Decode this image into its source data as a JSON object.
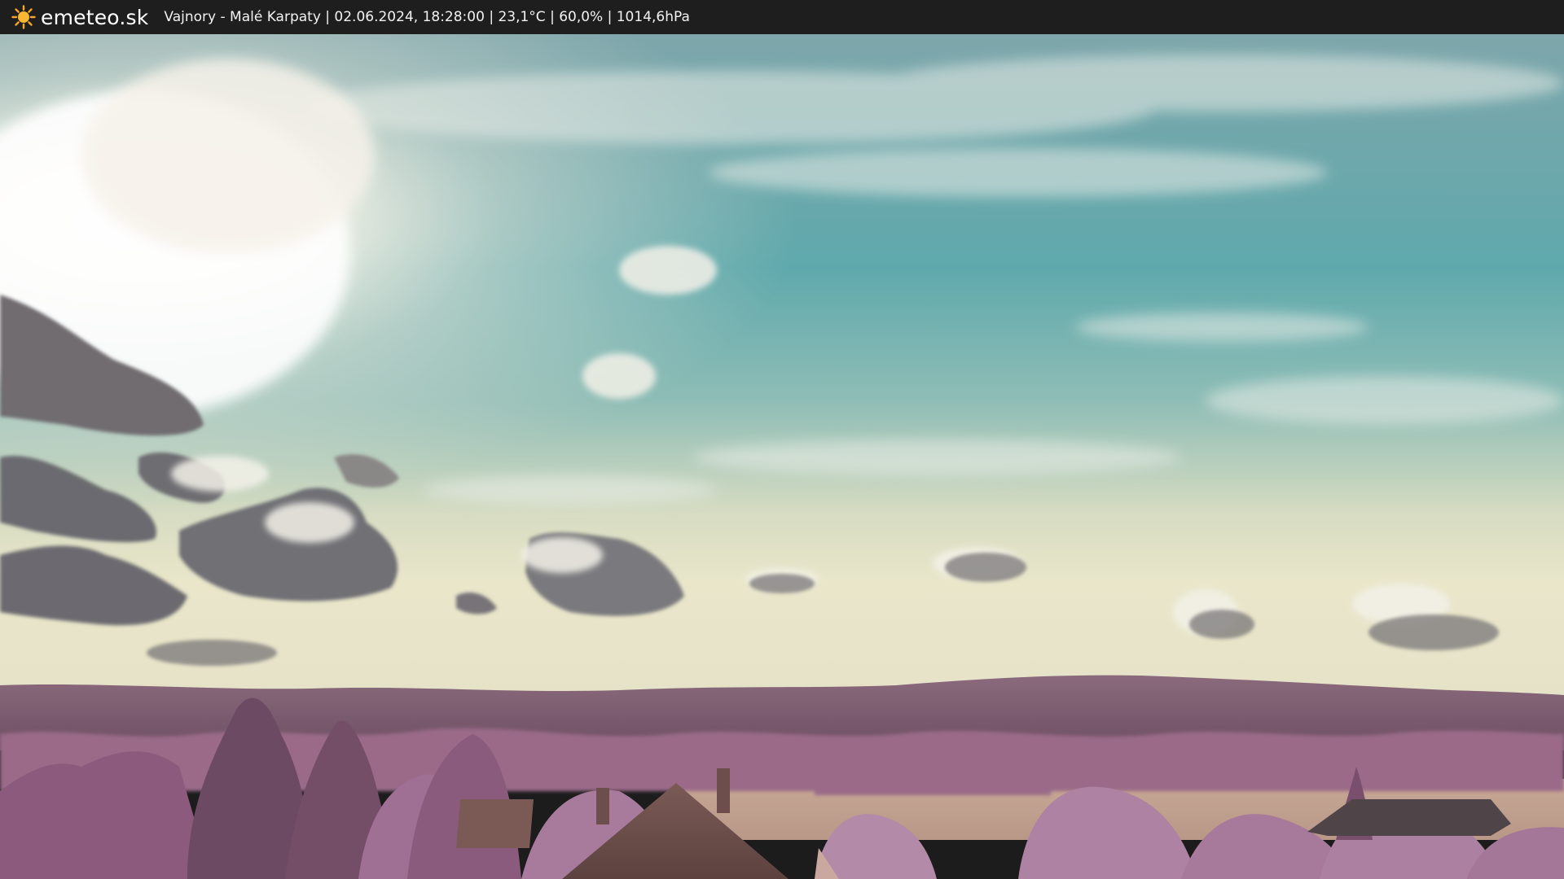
{
  "header": {
    "logo_icon": "sun-icon",
    "logo_text": "emeteo.sk",
    "caption": "Vajnory - Malé Karpaty | 02.06.2024, 18:28:00 | 23,1°C | 60,0% | 1014,6hPa"
  },
  "colors": {
    "bar_background": "#1e1e1e",
    "logo_sun": "#f5a623",
    "sky_top": "#7aa8ad",
    "sky_mid": "#62aeb0",
    "sky_horizon": "#e6e6c8",
    "hills": "#7a5a6e",
    "vegetation": "#9c6b8c",
    "field": "#c9a995"
  }
}
